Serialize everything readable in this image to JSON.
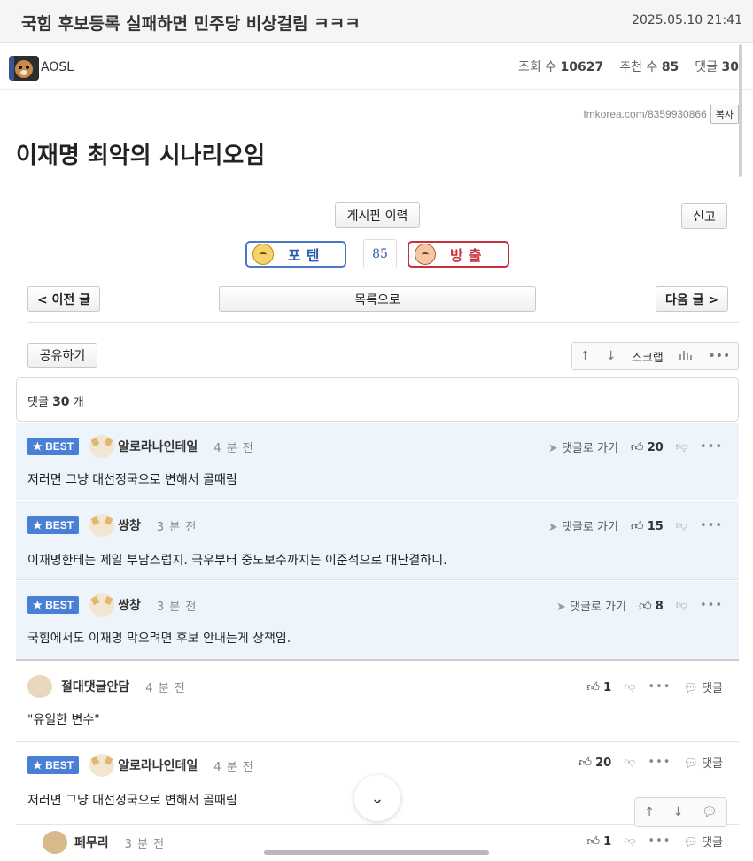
{
  "header": {
    "title": "국힘 후보등록 실패하면 민주당 비상걸림 ㅋㅋㅋ",
    "date": "2025.05.10 21:41"
  },
  "author": {
    "name": "AOSL",
    "views_label": "조회 수",
    "views": "10627",
    "recommend_label": "추천 수",
    "recommend": "85",
    "comments_label": "댓글",
    "comments": "30"
  },
  "post": {
    "url": "fmkorea.com/8359930866",
    "copy_label": "복사",
    "heading": "이재명 최악의 시나리오임",
    "board_history": "게시판 이력",
    "report": "신고",
    "vote_up_label": "포텐",
    "vote_down_label": "방출",
    "vote_count": "85"
  },
  "nav": {
    "prev": "< 이전 글",
    "list": "목록으로",
    "next": "다음 글 >",
    "share": "공유하기",
    "scrap": "스크랩"
  },
  "comment_count": {
    "prefix": "댓글",
    "count": "30",
    "suffix": "개"
  },
  "colors": {
    "best_badge": "#4a7fd6",
    "best_bg": "#eef4fc",
    "vote_up": "#4a78c4",
    "vote_down": "#c9303a"
  },
  "comments": [
    {
      "best": "★ BEST",
      "name": "알로라나인테일",
      "time": "4 분 전",
      "goto": "댓글로 가기",
      "likes": "20",
      "body": "저러면 그냥 대선정국으로 변해서 골때림"
    },
    {
      "best": "★ BEST",
      "name": "쌍창",
      "time": "3 분 전",
      "goto": "댓글로 가기",
      "likes": "15",
      "body": "이재명한테는 제일 부담스럽지. 극우부터 중도보수까지는 이준석으로 대단결하니."
    },
    {
      "best": "★ BEST",
      "name": "쌍창",
      "time": "3 분 전",
      "goto": "댓글로 가기",
      "likes": "8",
      "body": "국힘에서도 이재명 막으려면 후보 안내는게 상책임."
    },
    {
      "name": "절대댓글안담",
      "time": "4 분 전",
      "likes": "1",
      "reply": "댓글",
      "body": "\"유일한 변수\""
    },
    {
      "best": "★ BEST",
      "name": "알로라나인테일",
      "time": "4 분 전",
      "likes": "20",
      "reply": "댓글",
      "body": "저러면 그냥 대선정국으로 변해서 골때림"
    },
    {
      "name": "페무리",
      "time": "3 분 전",
      "likes": "1",
      "reply": "댓글"
    }
  ]
}
